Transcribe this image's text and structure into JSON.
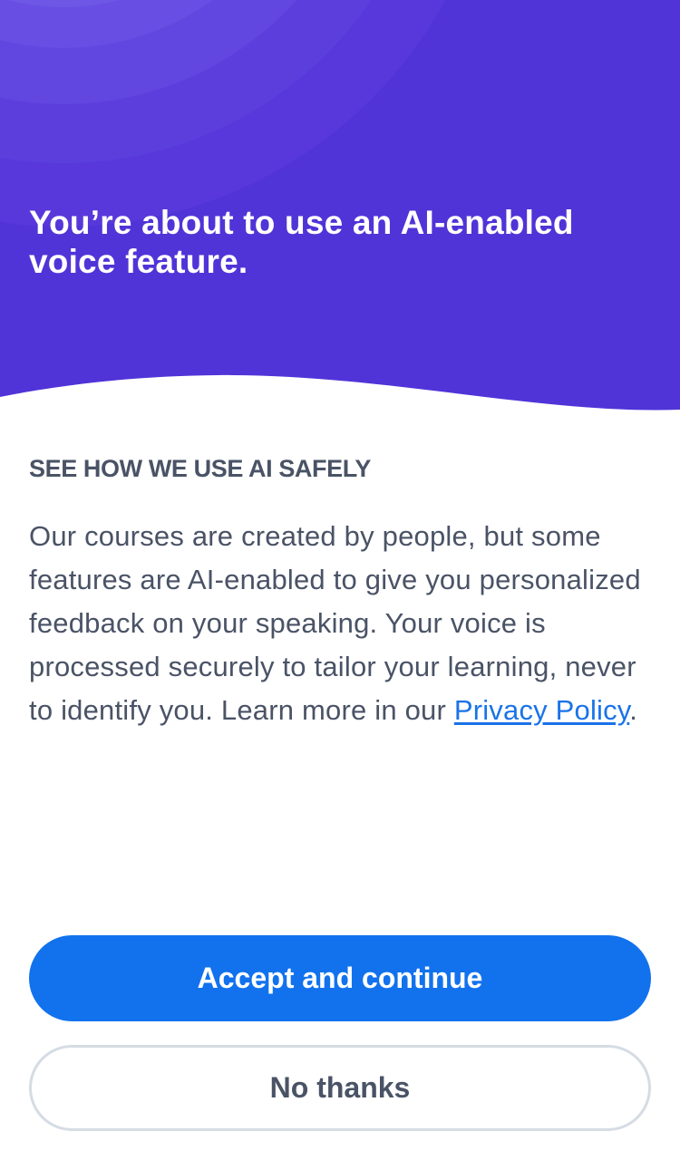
{
  "colors": {
    "hero_background": "#5034d8",
    "primary_button": "#1272ee",
    "text": "#4a5366",
    "link": "#1a73e8",
    "secondary_button_border": "#d5dce3"
  },
  "hero": {
    "title": "You’re about to use an AI-enabled voice feature."
  },
  "info": {
    "heading": "SEE HOW WE USE AI SAFELY",
    "body": "Our courses are created by people, but some features are AI-enabled to give you personalized feedback on your speaking. Your voice is processed securely to tailor your learning, never to identify you. Learn more in our ",
    "link_label": "Privacy Policy",
    "trailing": "."
  },
  "actions": {
    "accept_label": "Accept and continue",
    "decline_label": "No thanks"
  }
}
